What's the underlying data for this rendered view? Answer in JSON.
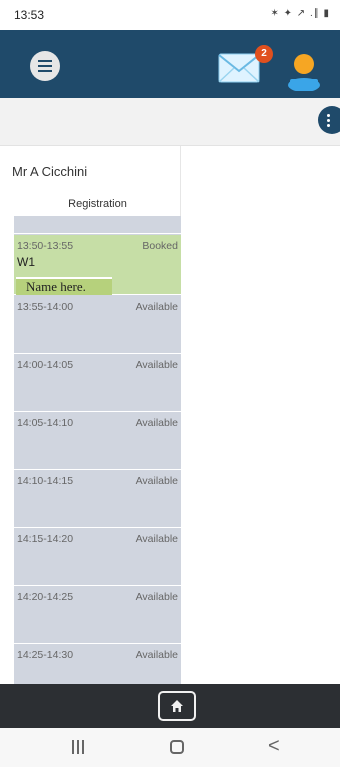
{
  "status_bar": {
    "time": "13:53",
    "icons": "✶ ✦ ↗ .∥ ▮"
  },
  "header": {
    "menu_icon": "hamburger-menu-icon",
    "mail_icon": "envelope-icon",
    "mail_badge": "2",
    "avatar_icon": "user-avatar-icon",
    "colors": {
      "header_bg": "#1f4a6a",
      "badge": "#e0501e"
    }
  },
  "toolbar": {
    "more_icon": "vertical-dots-icon"
  },
  "schedule": {
    "teacher": "Mr A Cicchini",
    "heading": "Registration",
    "slots": [
      {
        "time": "13:50-13:55",
        "status": "Booked",
        "room": "W1",
        "name_note": "Name here."
      },
      {
        "time": "13:55-14:00",
        "status": "Available"
      },
      {
        "time": "14:00-14:05",
        "status": "Available"
      },
      {
        "time": "14:05-14:10",
        "status": "Available"
      },
      {
        "time": "14:10-14:15",
        "status": "Available"
      },
      {
        "time": "14:15-14:20",
        "status": "Available"
      },
      {
        "time": "14:20-14:25",
        "status": "Available"
      },
      {
        "time": "14:25-14:30",
        "status": "Available"
      }
    ]
  },
  "bottom_bar": {
    "home_icon": "home-icon"
  },
  "system_nav": {
    "recents_icon": "recents-icon",
    "home_icon": "home-circle-icon",
    "back_icon": "back-chevron-icon",
    "back_glyph": "<"
  }
}
